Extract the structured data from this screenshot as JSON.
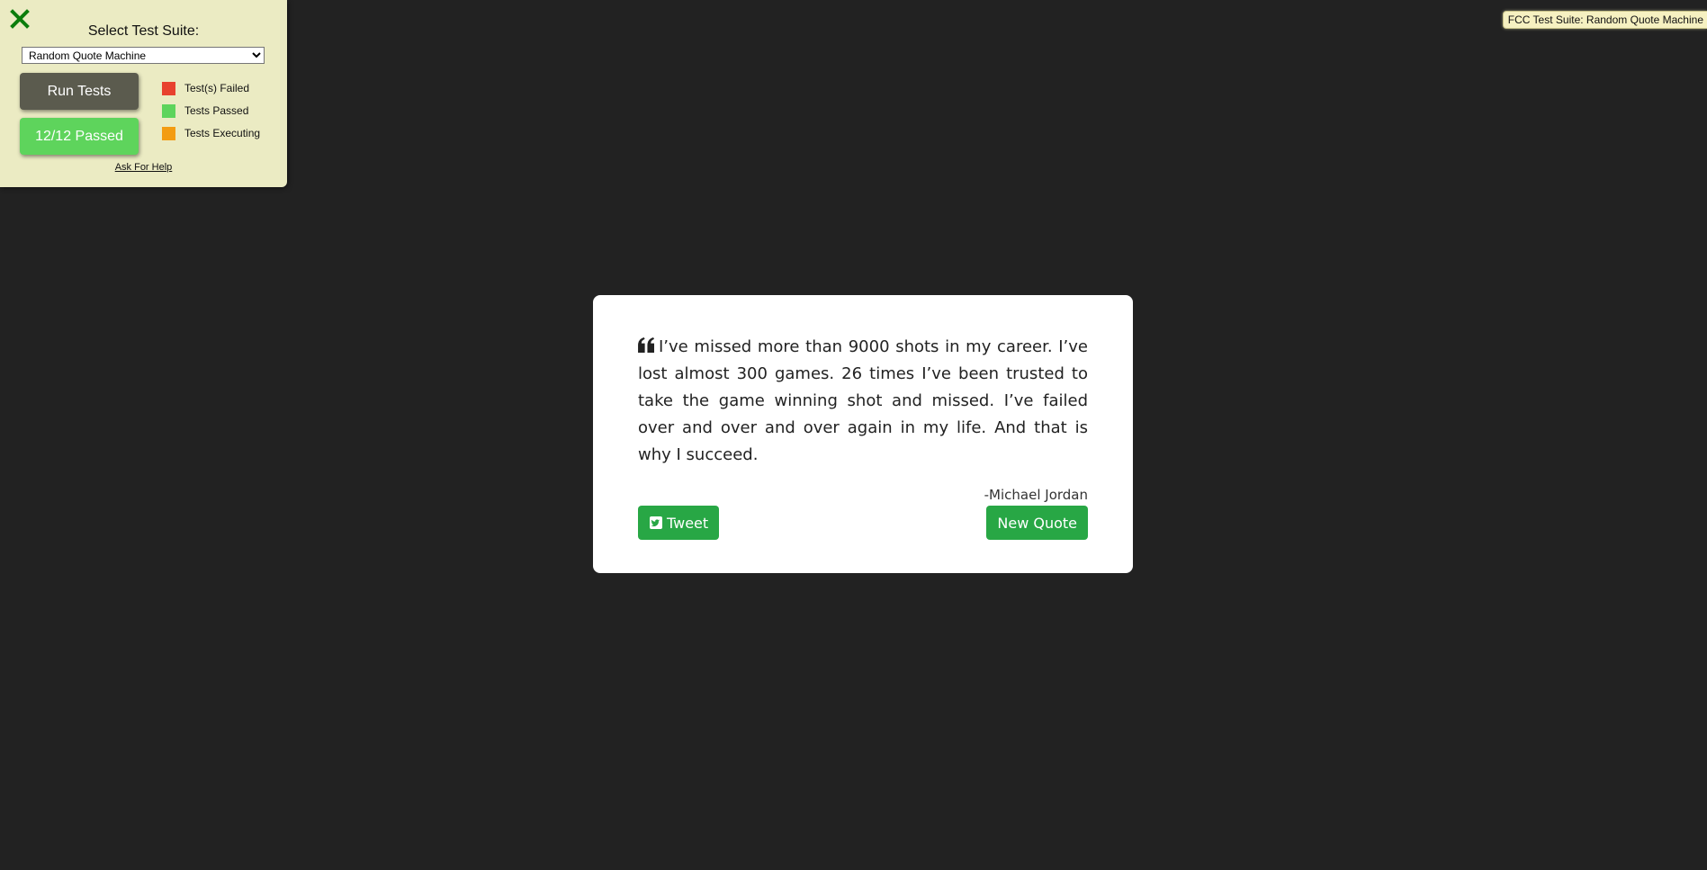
{
  "fcc_panel": {
    "title": "Select Test Suite:",
    "suite_select": {
      "value": "Random Quote Machine"
    },
    "run_tests_label": "Run Tests",
    "status_label": "12/12 Passed",
    "legend": [
      {
        "label": "Test(s) Failed",
        "color": "#e8412e"
      },
      {
        "label": "Tests Passed",
        "color": "#5ed45c"
      },
      {
        "label": "Tests Executing",
        "color": "#f39c12"
      }
    ],
    "help_link": "Ask For Help",
    "close_icon": "close-x-icon"
  },
  "fcc_tag": "FCC Test Suite: Random Quote Machine",
  "quote": {
    "text": "I’ve missed more than 9000 shots in my career. I’ve lost almost 300 games. 26 times I’ve been trusted to take the game winning shot and missed. I’ve failed over and over and over again in my life. And that is why I succeed.",
    "author": "-Michael Jordan",
    "quote_icon": "quote-left-icon"
  },
  "actions": {
    "tweet_label": "Tweet",
    "tweet_icon": "twitter-square-icon",
    "new_quote_label": "New Quote"
  },
  "colors": {
    "background": "#222222",
    "accent_green": "#28a745",
    "panel_bg": "#ebebc3"
  }
}
